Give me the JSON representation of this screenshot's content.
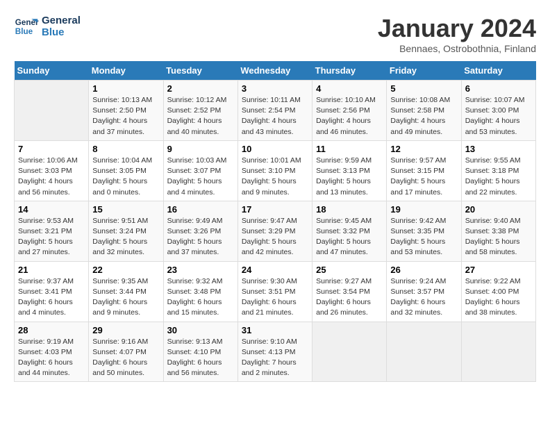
{
  "logo": {
    "line1": "General",
    "line2": "Blue"
  },
  "title": "January 2024",
  "subtitle": "Bennaes, Ostrobothnia, Finland",
  "days_header": [
    "Sunday",
    "Monday",
    "Tuesday",
    "Wednesday",
    "Thursday",
    "Friday",
    "Saturday"
  ],
  "weeks": [
    [
      {
        "num": "",
        "info": ""
      },
      {
        "num": "1",
        "info": "Sunrise: 10:13 AM\nSunset: 2:50 PM\nDaylight: 4 hours\nand 37 minutes."
      },
      {
        "num": "2",
        "info": "Sunrise: 10:12 AM\nSunset: 2:52 PM\nDaylight: 4 hours\nand 40 minutes."
      },
      {
        "num": "3",
        "info": "Sunrise: 10:11 AM\nSunset: 2:54 PM\nDaylight: 4 hours\nand 43 minutes."
      },
      {
        "num": "4",
        "info": "Sunrise: 10:10 AM\nSunset: 2:56 PM\nDaylight: 4 hours\nand 46 minutes."
      },
      {
        "num": "5",
        "info": "Sunrise: 10:08 AM\nSunset: 2:58 PM\nDaylight: 4 hours\nand 49 minutes."
      },
      {
        "num": "6",
        "info": "Sunrise: 10:07 AM\nSunset: 3:00 PM\nDaylight: 4 hours\nand 53 minutes."
      }
    ],
    [
      {
        "num": "7",
        "info": "Sunrise: 10:06 AM\nSunset: 3:03 PM\nDaylight: 4 hours\nand 56 minutes."
      },
      {
        "num": "8",
        "info": "Sunrise: 10:04 AM\nSunset: 3:05 PM\nDaylight: 5 hours\nand 0 minutes."
      },
      {
        "num": "9",
        "info": "Sunrise: 10:03 AM\nSunset: 3:07 PM\nDaylight: 5 hours\nand 4 minutes."
      },
      {
        "num": "10",
        "info": "Sunrise: 10:01 AM\nSunset: 3:10 PM\nDaylight: 5 hours\nand 9 minutes."
      },
      {
        "num": "11",
        "info": "Sunrise: 9:59 AM\nSunset: 3:13 PM\nDaylight: 5 hours\nand 13 minutes."
      },
      {
        "num": "12",
        "info": "Sunrise: 9:57 AM\nSunset: 3:15 PM\nDaylight: 5 hours\nand 17 minutes."
      },
      {
        "num": "13",
        "info": "Sunrise: 9:55 AM\nSunset: 3:18 PM\nDaylight: 5 hours\nand 22 minutes."
      }
    ],
    [
      {
        "num": "14",
        "info": "Sunrise: 9:53 AM\nSunset: 3:21 PM\nDaylight: 5 hours\nand 27 minutes."
      },
      {
        "num": "15",
        "info": "Sunrise: 9:51 AM\nSunset: 3:24 PM\nDaylight: 5 hours\nand 32 minutes."
      },
      {
        "num": "16",
        "info": "Sunrise: 9:49 AM\nSunset: 3:26 PM\nDaylight: 5 hours\nand 37 minutes."
      },
      {
        "num": "17",
        "info": "Sunrise: 9:47 AM\nSunset: 3:29 PM\nDaylight: 5 hours\nand 42 minutes."
      },
      {
        "num": "18",
        "info": "Sunrise: 9:45 AM\nSunset: 3:32 PM\nDaylight: 5 hours\nand 47 minutes."
      },
      {
        "num": "19",
        "info": "Sunrise: 9:42 AM\nSunset: 3:35 PM\nDaylight: 5 hours\nand 53 minutes."
      },
      {
        "num": "20",
        "info": "Sunrise: 9:40 AM\nSunset: 3:38 PM\nDaylight: 5 hours\nand 58 minutes."
      }
    ],
    [
      {
        "num": "21",
        "info": "Sunrise: 9:37 AM\nSunset: 3:41 PM\nDaylight: 6 hours\nand 4 minutes."
      },
      {
        "num": "22",
        "info": "Sunrise: 9:35 AM\nSunset: 3:44 PM\nDaylight: 6 hours\nand 9 minutes."
      },
      {
        "num": "23",
        "info": "Sunrise: 9:32 AM\nSunset: 3:48 PM\nDaylight: 6 hours\nand 15 minutes."
      },
      {
        "num": "24",
        "info": "Sunrise: 9:30 AM\nSunset: 3:51 PM\nDaylight: 6 hours\nand 21 minutes."
      },
      {
        "num": "25",
        "info": "Sunrise: 9:27 AM\nSunset: 3:54 PM\nDaylight: 6 hours\nand 26 minutes."
      },
      {
        "num": "26",
        "info": "Sunrise: 9:24 AM\nSunset: 3:57 PM\nDaylight: 6 hours\nand 32 minutes."
      },
      {
        "num": "27",
        "info": "Sunrise: 9:22 AM\nSunset: 4:00 PM\nDaylight: 6 hours\nand 38 minutes."
      }
    ],
    [
      {
        "num": "28",
        "info": "Sunrise: 9:19 AM\nSunset: 4:03 PM\nDaylight: 6 hours\nand 44 minutes."
      },
      {
        "num": "29",
        "info": "Sunrise: 9:16 AM\nSunset: 4:07 PM\nDaylight: 6 hours\nand 50 minutes."
      },
      {
        "num": "30",
        "info": "Sunrise: 9:13 AM\nSunset: 4:10 PM\nDaylight: 6 hours\nand 56 minutes."
      },
      {
        "num": "31",
        "info": "Sunrise: 9:10 AM\nSunset: 4:13 PM\nDaylight: 7 hours\nand 2 minutes."
      },
      {
        "num": "",
        "info": ""
      },
      {
        "num": "",
        "info": ""
      },
      {
        "num": "",
        "info": ""
      }
    ]
  ]
}
